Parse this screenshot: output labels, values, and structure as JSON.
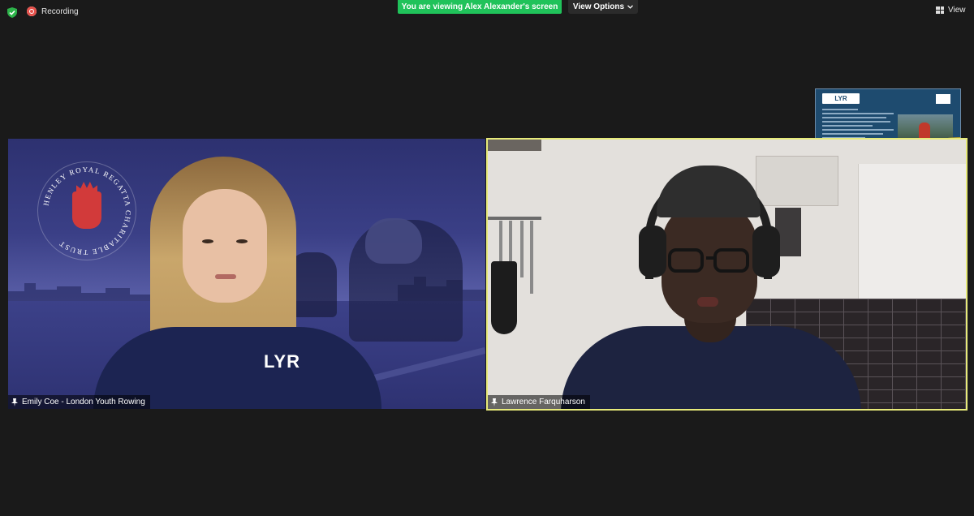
{
  "topbar": {
    "recording_label": "Recording",
    "viewing_banner": "You are viewing Alex Alexander's screen",
    "view_options_label": "View Options",
    "view_label": "View"
  },
  "tiles": [
    {
      "participant_name": "Emily Coe - London Youth Rowing",
      "speaking": false
    },
    {
      "participant_name": "Lawrence Farquharson",
      "speaking": true
    }
  ],
  "background": {
    "crest_text": "HENLEY ROYAL REGATTA CHARITABLE TRUST",
    "shirt_logo": "LYR"
  },
  "shared_screen": {
    "logo": "LYR"
  },
  "colors": {
    "viewing_banner_bg": "#20c25a",
    "active_speaker_border": "#e7ea7a",
    "recording_dot": "#e5514b",
    "app_bg": "#1a1a1a"
  },
  "icons": [
    "shield-check-icon",
    "record-icon",
    "chevron-down-icon",
    "grid-view-icon",
    "pin-icon"
  ]
}
